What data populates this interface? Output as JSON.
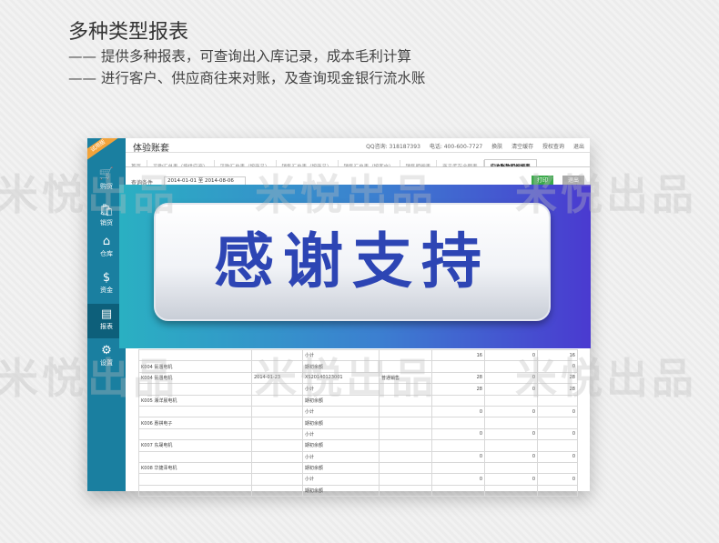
{
  "header": {
    "title": "多种类型报表",
    "line1": "—— 提供多种报表，可查询出入库记录，成本毛利计算",
    "line2": "—— 进行客户、供应商往来对账，及查询现金银行流水账"
  },
  "watermark": "米悦出品",
  "app": {
    "badge": "试用版",
    "title": "体验账套",
    "top_links": [
      "QQ咨询: 318187393",
      "电话: 400-600-7727",
      "换肤",
      "清空缓存",
      "授权查询",
      "退出"
    ],
    "sidebar": [
      {
        "label": "购货",
        "icon": "shopping-basket-icon",
        "glyph": "🛒"
      },
      {
        "label": "销货",
        "icon": "cart-icon",
        "glyph": "🛍"
      },
      {
        "label": "仓库",
        "icon": "warehouse-icon",
        "glyph": "⌂"
      },
      {
        "label": "资金",
        "icon": "dollar-icon",
        "glyph": "$"
      },
      {
        "label": "报表",
        "icon": "report-icon",
        "glyph": "▤"
      },
      {
        "label": "设置",
        "icon": "gear-icon",
        "glyph": "⚙"
      }
    ],
    "tabs": [
      "首页",
      "采购汇总表（按供应商）",
      "采购汇总表（按商品）",
      "销售汇总表（按商品）",
      "销售汇总表（按客户）",
      "销售明细表",
      "商品库存余额表",
      "应收账款明细报表"
    ],
    "query": {
      "label": "查询条件",
      "range": "2014-01-01 至 2014-08-06",
      "print": "打印",
      "exit": "退出"
    },
    "rows": [
      [
        "",
        "",
        "小计",
        "",
        "16",
        "0",
        "16"
      ],
      [
        "K004 氨涠电机",
        "",
        "期初余额",
        "",
        "",
        "",
        "0"
      ],
      [
        "K004 氨涠电机",
        "2014-01-23",
        "XS20140123001",
        "普通销售",
        "28",
        "0",
        "28"
      ],
      [
        "",
        "",
        "小计",
        "",
        "28",
        "0",
        "28"
      ],
      [
        "K005 湘洋晨电机",
        "",
        "期初余额",
        "",
        "",
        "",
        ""
      ],
      [
        "",
        "",
        "小计",
        "",
        "0",
        "0",
        "0"
      ],
      [
        "K006 惠祺电子",
        "",
        "期初余额",
        "",
        "",
        "",
        ""
      ],
      [
        "",
        "",
        "小计",
        "",
        "0",
        "0",
        "0"
      ],
      [
        "K007 东晟电机",
        "",
        "期初余额",
        "",
        "",
        "",
        ""
      ],
      [
        "",
        "",
        "小计",
        "",
        "0",
        "0",
        "0"
      ],
      [
        "K008 华捷泽电机",
        "",
        "期初余额",
        "",
        "",
        "",
        ""
      ],
      [
        "",
        "",
        "小计",
        "",
        "0",
        "0",
        "0"
      ],
      [
        "",
        "",
        "期初余额",
        "",
        "",
        "",
        ""
      ]
    ]
  },
  "banner": {
    "text": "感谢支持"
  }
}
